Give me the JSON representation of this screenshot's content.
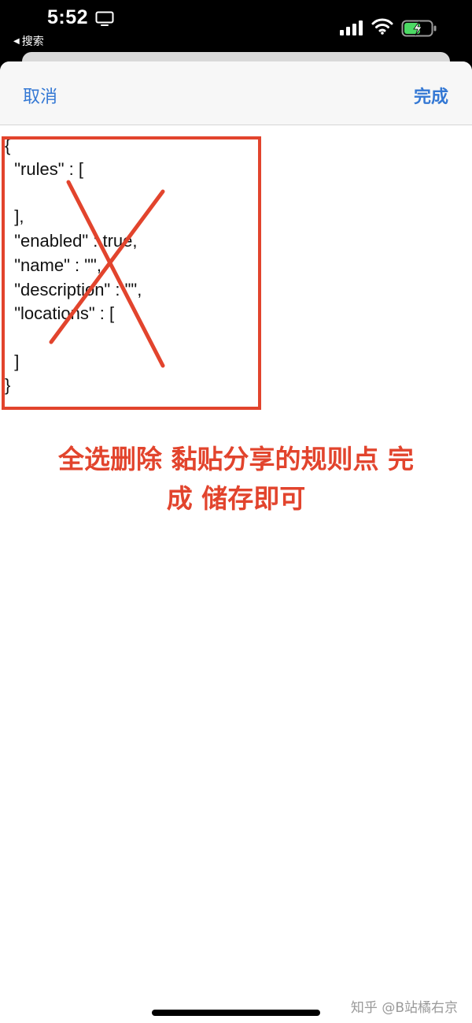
{
  "status_bar": {
    "time": "5:52",
    "back_label": "搜索",
    "icons": [
      "tv-icon",
      "signal-icon",
      "wifi-icon",
      "battery-charging-icon"
    ]
  },
  "nav": {
    "cancel_label": "取消",
    "done_label": "完成",
    "accent_color": "#3478d4"
  },
  "editor": {
    "lines": [
      "{",
      "  \"rules\" : [",
      "",
      "  ],",
      "  \"enabled\" : true,",
      "  \"name\" : \"\",",
      "  \"description\" : \"\",",
      "  \"locations\" : [",
      "",
      "  ]",
      "}"
    ]
  },
  "annotation": {
    "instruction_line1": "全选删除 黏贴分享的规则点 完",
    "instruction_line2": "成 储存即可",
    "color": "#e2442d"
  },
  "watermark": "知乎 @B站橘右京"
}
